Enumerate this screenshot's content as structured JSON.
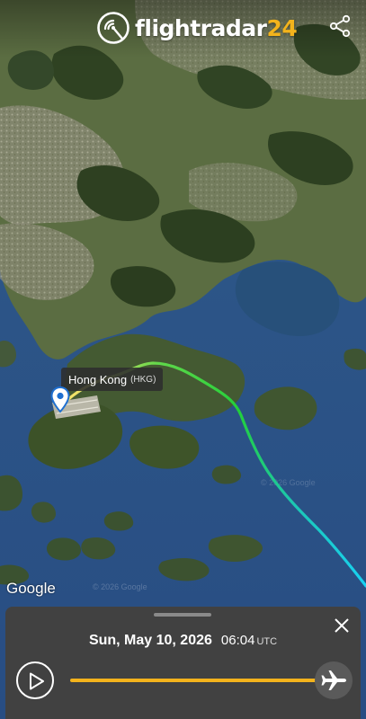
{
  "header": {
    "brand": "flightradar",
    "brand_number": "24"
  },
  "map": {
    "airport_name": "Hong Kong",
    "airport_code": "(HKG)",
    "provider_logo": "Google",
    "copyright": "© 2026 Google",
    "colors": {
      "track_start": "#f7e36a",
      "track_mid": "#22cf3a",
      "track_end": "#18d2f5",
      "water": "#2a4f85",
      "land": "#556b3a"
    }
  },
  "playback": {
    "date": "Sun, May 10, 2026",
    "time": "06:04",
    "timezone": "UTC",
    "progress_fraction": 1.0,
    "accent_color": "#f3b31c"
  },
  "icons": {
    "logo": "radar-logo-icon",
    "share": "share-icon",
    "close": "close-icon",
    "play": "play-icon",
    "aircraft": "aircraft-icon",
    "pin": "map-pin-icon"
  }
}
